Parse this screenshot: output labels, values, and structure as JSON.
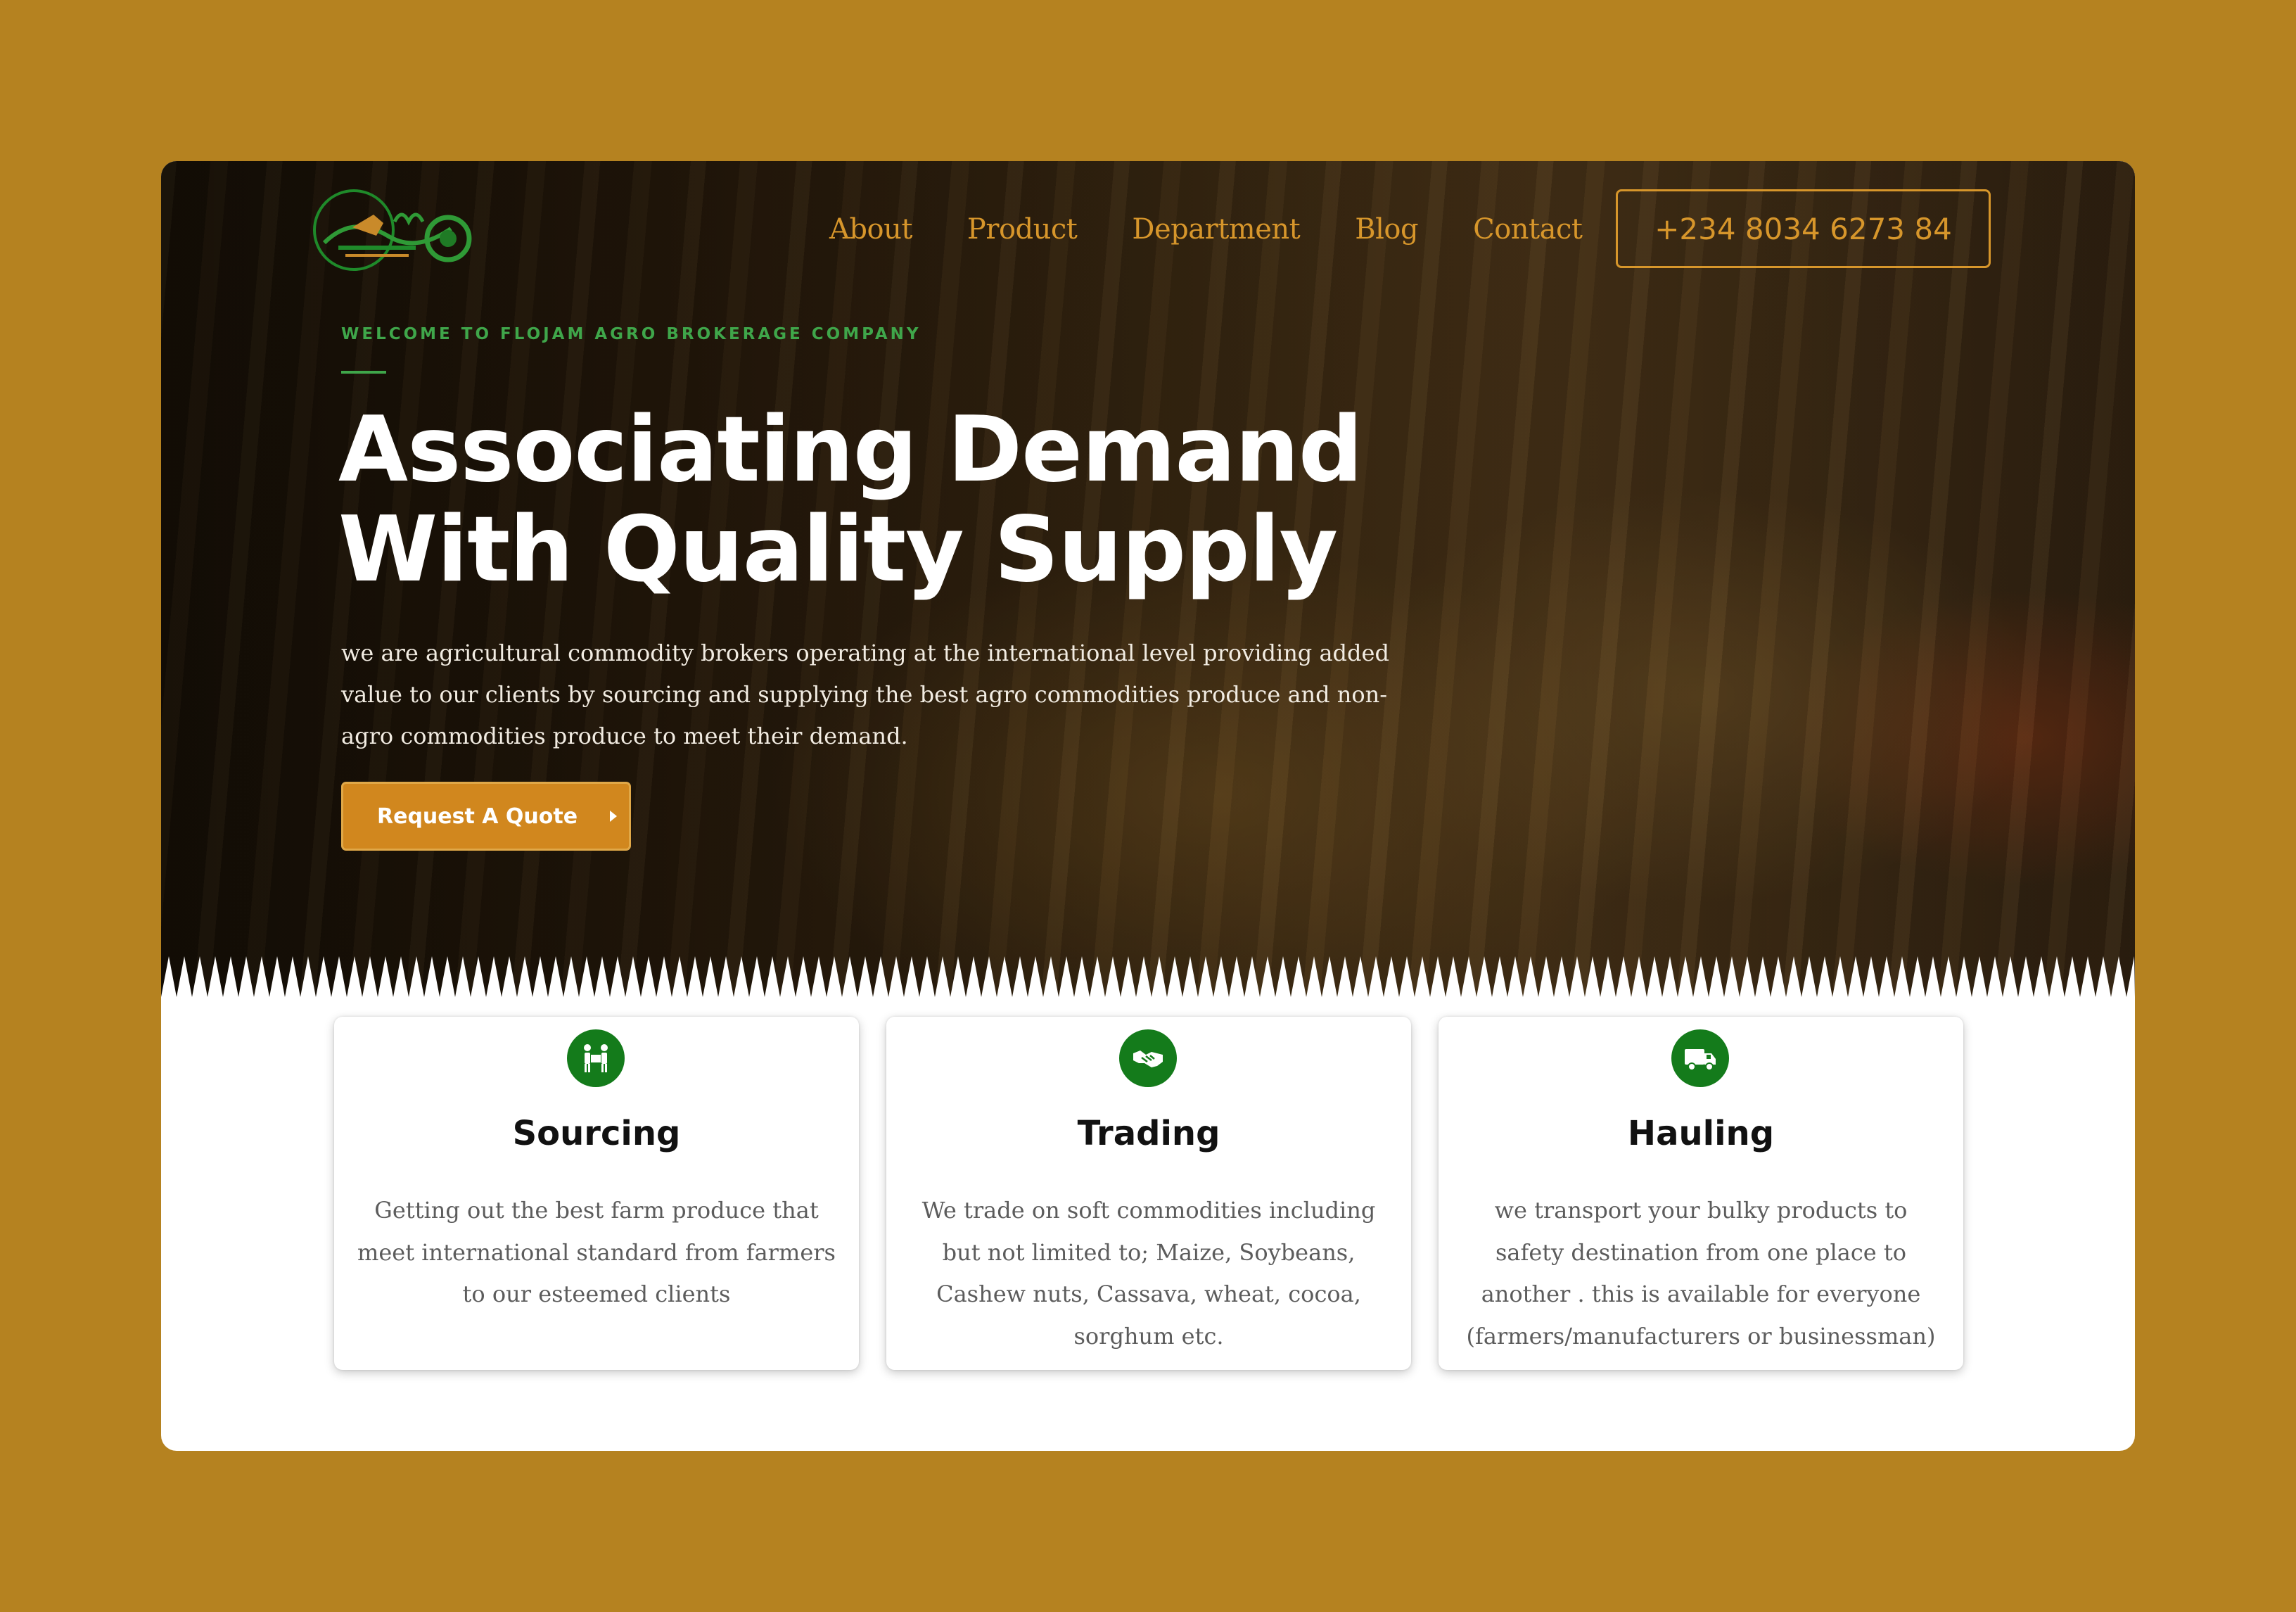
{
  "nav": {
    "items": [
      "About",
      "Product",
      "Department",
      "Blog",
      "Contact"
    ],
    "phone": "+234 8034 6273 84"
  },
  "hero": {
    "eyebrow": "WELCOME TO FLOJAM AGRO BROKERAGE COMPANY",
    "headline_line1": "Associating Demand",
    "headline_line2": "With Quality Supply",
    "lede": "we are agricultural commodity brokers operating at the international level providing added value to our clients by sourcing and supplying the best agro commodities produce and non-agro commodities produce to meet their demand.",
    "cta_label": "Request A Quote"
  },
  "services": [
    {
      "icon": "people-carrying-box-icon",
      "title": "Sourcing",
      "text": "Getting out the best farm produce that meet international standard from farmers to our esteemed clients"
    },
    {
      "icon": "handshake-icon",
      "title": "Trading",
      "text": "We trade on soft commodities including but not limited to; Maize, Soybeans, Cashew nuts, Cassava, wheat, cocoa, sorghum etc."
    },
    {
      "icon": "truck-icon",
      "title": "Hauling",
      "text": "we transport your bulky products to safety destination from one place to another . this is available for everyone (farmers/manufacturers or businessman)"
    }
  ],
  "colors": {
    "page_background": "#b58220",
    "accent_gold": "#d7962b",
    "cta_orange": "#d1871e",
    "brand_green": "#147b1b",
    "eyebrow_green": "#3fa64a"
  }
}
